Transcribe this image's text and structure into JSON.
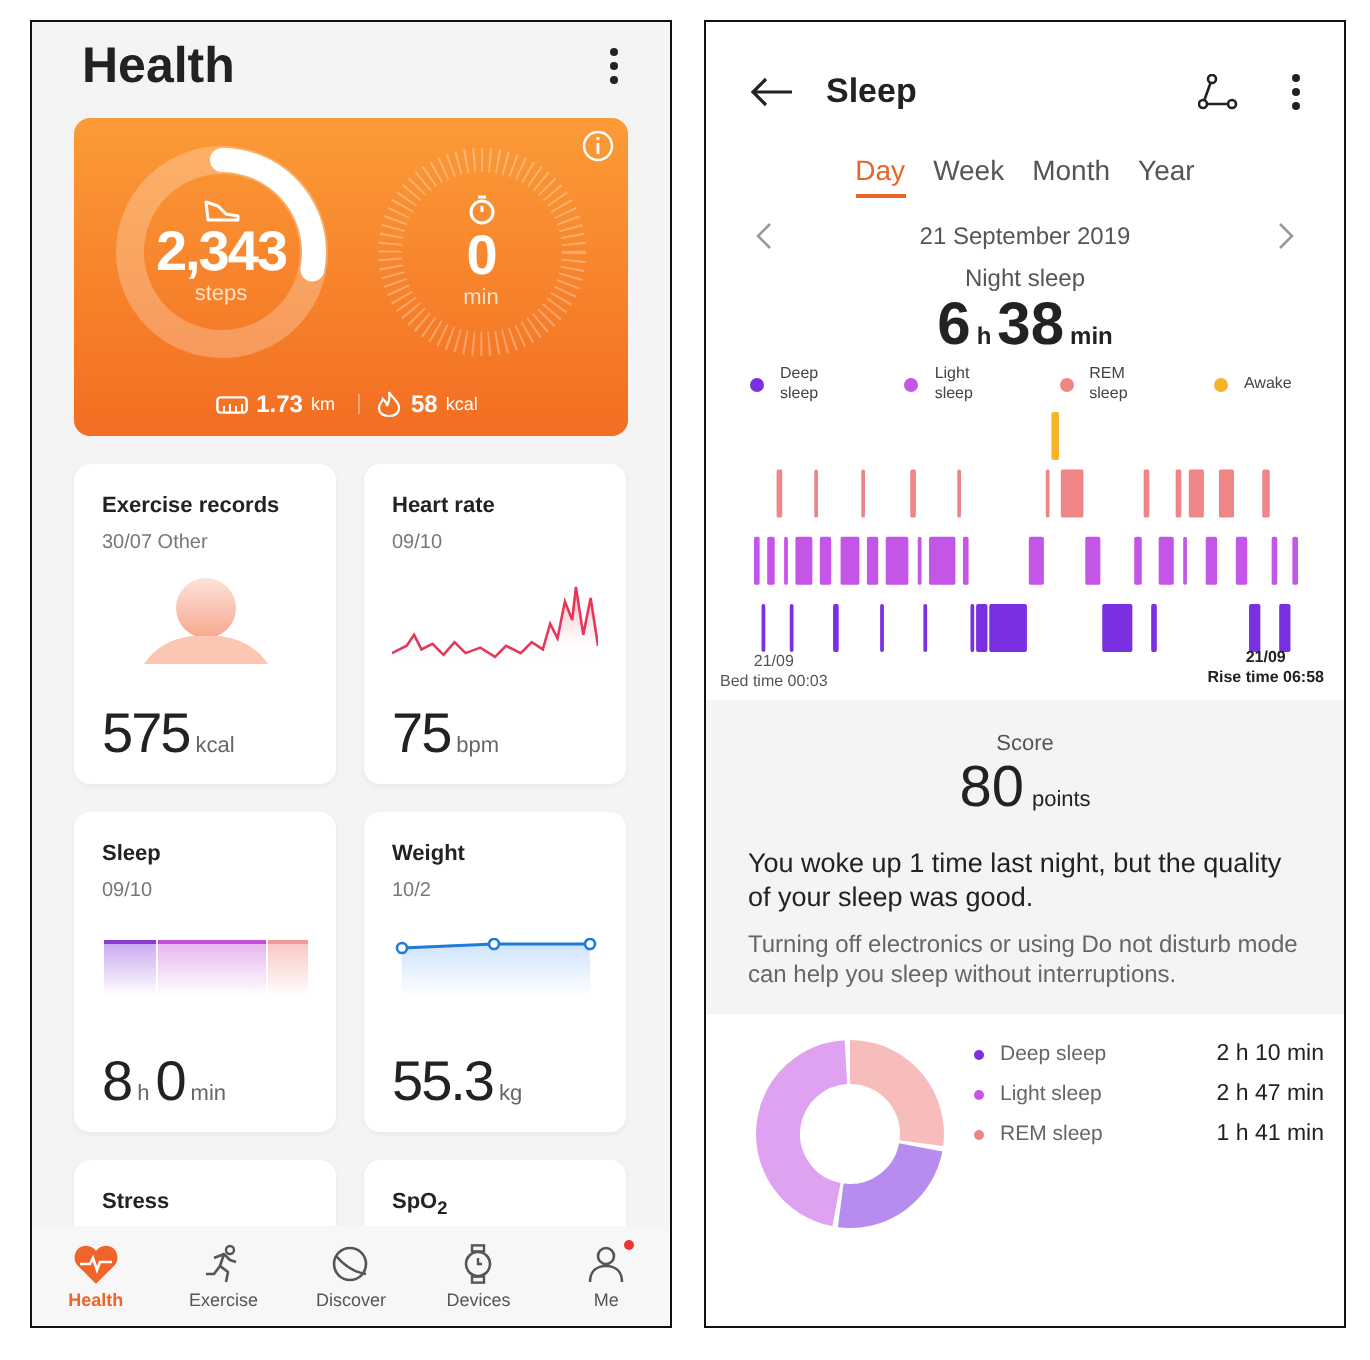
{
  "health": {
    "title": "Health",
    "activity": {
      "steps": "2,343",
      "steps_unit": "steps",
      "level": 0.28,
      "minutes": "0",
      "minutes_unit": "min",
      "distance": "1.73",
      "distance_unit": "km",
      "calories": "58",
      "calories_unit": "kcal"
    },
    "cards": [
      {
        "kind": "exercise",
        "title": "Exercise records",
        "subtitle": "30/07 Other",
        "reading": [
          {
            "text": "575",
            "kind": "number"
          },
          {
            "text": "kcal",
            "kind": "unit"
          }
        ]
      },
      {
        "kind": "heart",
        "title": "Heart rate",
        "subtitle": "09/10",
        "reading": [
          {
            "text": "75",
            "kind": "number"
          },
          {
            "text": "bpm",
            "kind": "unit"
          }
        ]
      },
      {
        "kind": "sleep",
        "title": "Sleep",
        "subtitle": "09/10",
        "reading": [
          {
            "text": "8",
            "kind": "number"
          },
          {
            "text": "h",
            "kind": "unit"
          },
          {
            "text": "0",
            "kind": "number"
          },
          {
            "text": "min",
            "kind": "unit"
          }
        ]
      },
      {
        "kind": "weight",
        "title": "Weight",
        "subtitle": "10/2",
        "reading": [
          {
            "text": "55.3",
            "kind": "number"
          },
          {
            "text": "kg",
            "kind": "unit"
          }
        ]
      },
      {
        "kind": "stub",
        "title": "Stress"
      },
      {
        "kind": "stub",
        "title": "SpO$_{2}$"
      }
    ],
    "nav": [
      {
        "label": "Health",
        "selected": true,
        "badge": false
      },
      {
        "label": "Exercise",
        "selected": false,
        "badge": false
      },
      {
        "label": "Discover",
        "selected": false,
        "badge": false
      },
      {
        "label": "Devices",
        "selected": false,
        "badge": false
      },
      {
        "label": "Me",
        "selected": false,
        "badge": true
      }
    ]
  },
  "sleep": {
    "title": "Sleep",
    "tabs": [
      {
        "label": "Day",
        "selected": true
      },
      {
        "label": "Week",
        "selected": false
      },
      {
        "label": "Month",
        "selected": false
      },
      {
        "label": "Year",
        "selected": false
      }
    ],
    "date": "21 September 2019",
    "period": "Night sleep",
    "total": [
      {
        "text": "6",
        "kind": "number"
      },
      {
        "text": "h",
        "kind": "unit"
      },
      {
        "text": "38",
        "kind": "number"
      },
      {
        "text": "min",
        "kind": "unit"
      }
    ],
    "legend": [
      {
        "label": "Deep sleep",
        "color": "#7a2fe0"
      },
      {
        "label": "Light sleep",
        "color": "#c455e6"
      },
      {
        "label": "REM sleep",
        "color": "#f08585"
      },
      {
        "label": "Awake",
        "color": "#f7b526"
      }
    ],
    "bed": {
      "date": "21/09",
      "time": "Bed time 00:03"
    },
    "rise": {
      "date": "21/09",
      "time": "Rise time 06:58"
    },
    "score_label": "Score",
    "score": "80",
    "score_unit": "points",
    "summary": "You woke up 1 time last night, but the quality of your sleep was good.",
    "tip": "Turning off electronics or using Do not disturb mode can help you sleep without interruptions.",
    "breakdown": [
      {
        "label": "Deep sleep",
        "duration": "2 h 10 min",
        "color": "#7a2fe0"
      },
      {
        "label": "Light sleep",
        "duration": "2 h 47 min",
        "color": "#c455e6"
      },
      {
        "label": "REM sleep",
        "duration": "1 h 41 min",
        "color": "#f08585"
      }
    ]
  }
}
